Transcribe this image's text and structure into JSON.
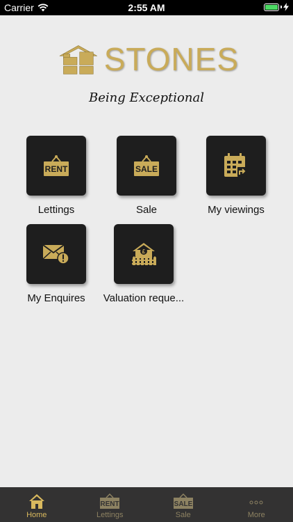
{
  "status": {
    "carrier": "Carrier",
    "time": "2:55 AM"
  },
  "brand": {
    "name": "STONES",
    "tagline": "Being Exceptional"
  },
  "tiles": [
    {
      "label": "Lettings",
      "sign": "RENT"
    },
    {
      "label": "Sale",
      "sign": "SALE"
    },
    {
      "label": "My viewings"
    },
    {
      "label": "My Enquires"
    },
    {
      "label": "Valuation reque..."
    }
  ],
  "tabbar": {
    "items": [
      {
        "label": "Home"
      },
      {
        "label": "Lettings",
        "sign": "RENT"
      },
      {
        "label": "Sale",
        "sign": "SALE"
      },
      {
        "label": "More"
      }
    ]
  },
  "colors": {
    "accent": "#c9ab59",
    "tile": "#1e1e1e",
    "tabbar": "#333232",
    "battery": "#4cd964"
  }
}
